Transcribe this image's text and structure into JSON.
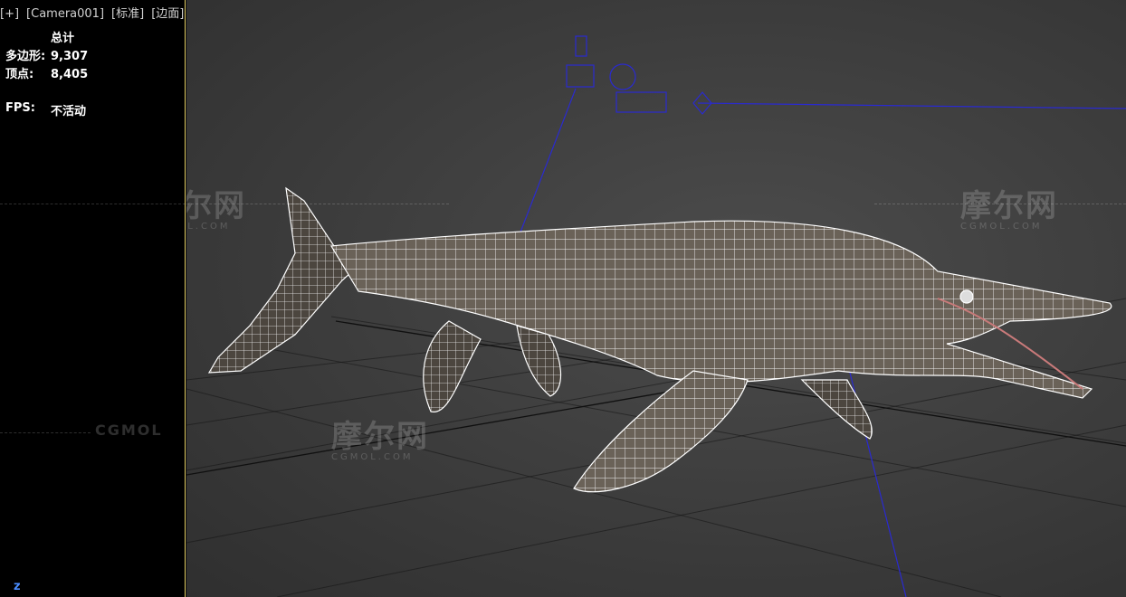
{
  "viewport": {
    "labels": [
      "[+]",
      "[Camera001]",
      "[标准]",
      "[边面]"
    ]
  },
  "stats": {
    "header": "总计",
    "polygons_label": "多边形:",
    "polygons_value": "9,307",
    "vertices_label": "顶点:",
    "vertices_value": "8,405",
    "fps_label": "FPS:",
    "fps_value": "不活动"
  },
  "axis_label": "z",
  "watermark": {
    "text": "摩尔网",
    "sub": "CGMOL.COM",
    "left_text": "CGMOL"
  },
  "colors": {
    "viewport_border": "#e8d36a",
    "camera_gizmo": "#2a2ad0",
    "wire": "#ffffff"
  },
  "icons": [
    "camera-icon",
    "light-icon",
    "target-icon"
  ]
}
